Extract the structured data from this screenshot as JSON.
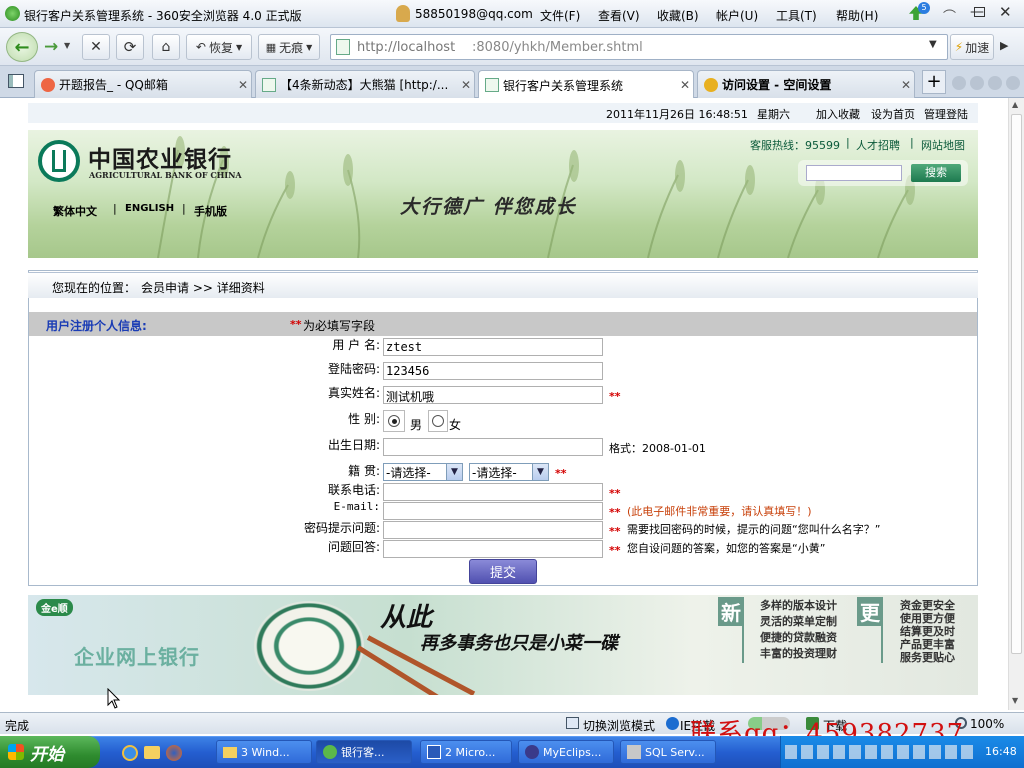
{
  "window": {
    "title": "银行客户关系管理系统 - 360安全浏览器 4.0 正式版",
    "account": "58850198@qq.com",
    "menu": [
      "文件(F)",
      "查看(V)",
      "收藏(B)",
      "帐户(U)",
      "工具(T)",
      "帮助(H)"
    ],
    "notify_count": "5"
  },
  "nav": {
    "restore_label": "恢复",
    "traceless_label": "无痕",
    "address_host": "http://localhost",
    "address_rest": ":8080/yhkh/Member.shtml",
    "speedup_label": "加速"
  },
  "tabs": [
    {
      "label": "开题报告_ - QQ邮箱"
    },
    {
      "label": "【4条新动态】大熊猫 [http:/..."
    },
    {
      "label": "银行客户关系管理系统"
    },
    {
      "label": "访问设置 - 空间设置"
    }
  ],
  "topinfo": {
    "datetime": "2011年11月26日  16:48:51",
    "weekday": "星期六",
    "links": [
      "加入收藏",
      "设为首页",
      "管理登陆"
    ]
  },
  "banner": {
    "bank_name_cn": "中国农业银行",
    "bank_name_en": "AGRICULTURAL BANK OF CHINA",
    "hotline": "客服热线：95599",
    "recruit": "人才招聘",
    "sitemap": "网站地图",
    "search_button": "搜索",
    "slogan": "大行德广  伴您成长",
    "langs": [
      "繁体中文",
      "ENGLISH",
      "手机版"
    ]
  },
  "crumb": {
    "prefix": "您现在的位置：",
    "path": "会员申请 >> 详细资料"
  },
  "form": {
    "heading": "用户注册个人信息:",
    "required_note_mark": "**",
    "required_note": "为必填写字段",
    "username_label": "用 户 名:",
    "username_value": "ztest",
    "password_label": "登陆密码:",
    "password_value": "123456",
    "realname_label": "真实姓名:",
    "realname_value": "测试机哦",
    "gender_label": "性    别:",
    "gender_male": "男",
    "gender_female": "女",
    "birthday_label": "出生日期:",
    "birthday_hint": "格式：2008-01-01",
    "native_label": "籍    贯:",
    "select_province": "-请选择-",
    "select_city": "-请选择-",
    "phone_label": "联系电话:",
    "email_label": "E-mail:",
    "email_hint": "(此电子邮件非常重要，请认真填写！)",
    "question_label": "密码提示问题:",
    "question_hint": "需要找回密码的时候，提示的问题“您叫什么名字？”",
    "answer_label": "问题回答:",
    "answer_hint": "您自设问题的答案，如您的答案是“小黄”",
    "req": "**",
    "submit": "提交"
  },
  "footer_banner": {
    "logo": "金e顺",
    "left_title": "企业网上银行",
    "headline1": "从此",
    "headline2": "再多事务也只是小菜一碟",
    "badge_new": "新",
    "badge_more": "更",
    "features": [
      "多样的版本设计",
      "灵活的菜单定制",
      "便捷的贷款融资",
      "丰富的投资理财"
    ],
    "benefits": [
      "资金更安全",
      "使用更方便",
      "结算更及时",
      "产品更丰富",
      "服务更贴心"
    ]
  },
  "statusbar": {
    "status": "完成",
    "mode": "切换浏览模式",
    "ie_label": "IE拦截",
    "download": "下载",
    "zoom": "100%"
  },
  "watermark": "联系qq：459382737",
  "taskbar": {
    "start": "开始",
    "items": [
      "3 Wind...",
      "银行客...",
      "2 Micro...",
      "MyEclips...",
      "SQL Serv..."
    ],
    "clock": "16:48"
  },
  "colors": {
    "form_heading": "#1a3cb5",
    "required": "#d40000",
    "hint_orange": "#c8400a",
    "submit_bg": "#6262c2",
    "taskbar": "#245ed0"
  }
}
